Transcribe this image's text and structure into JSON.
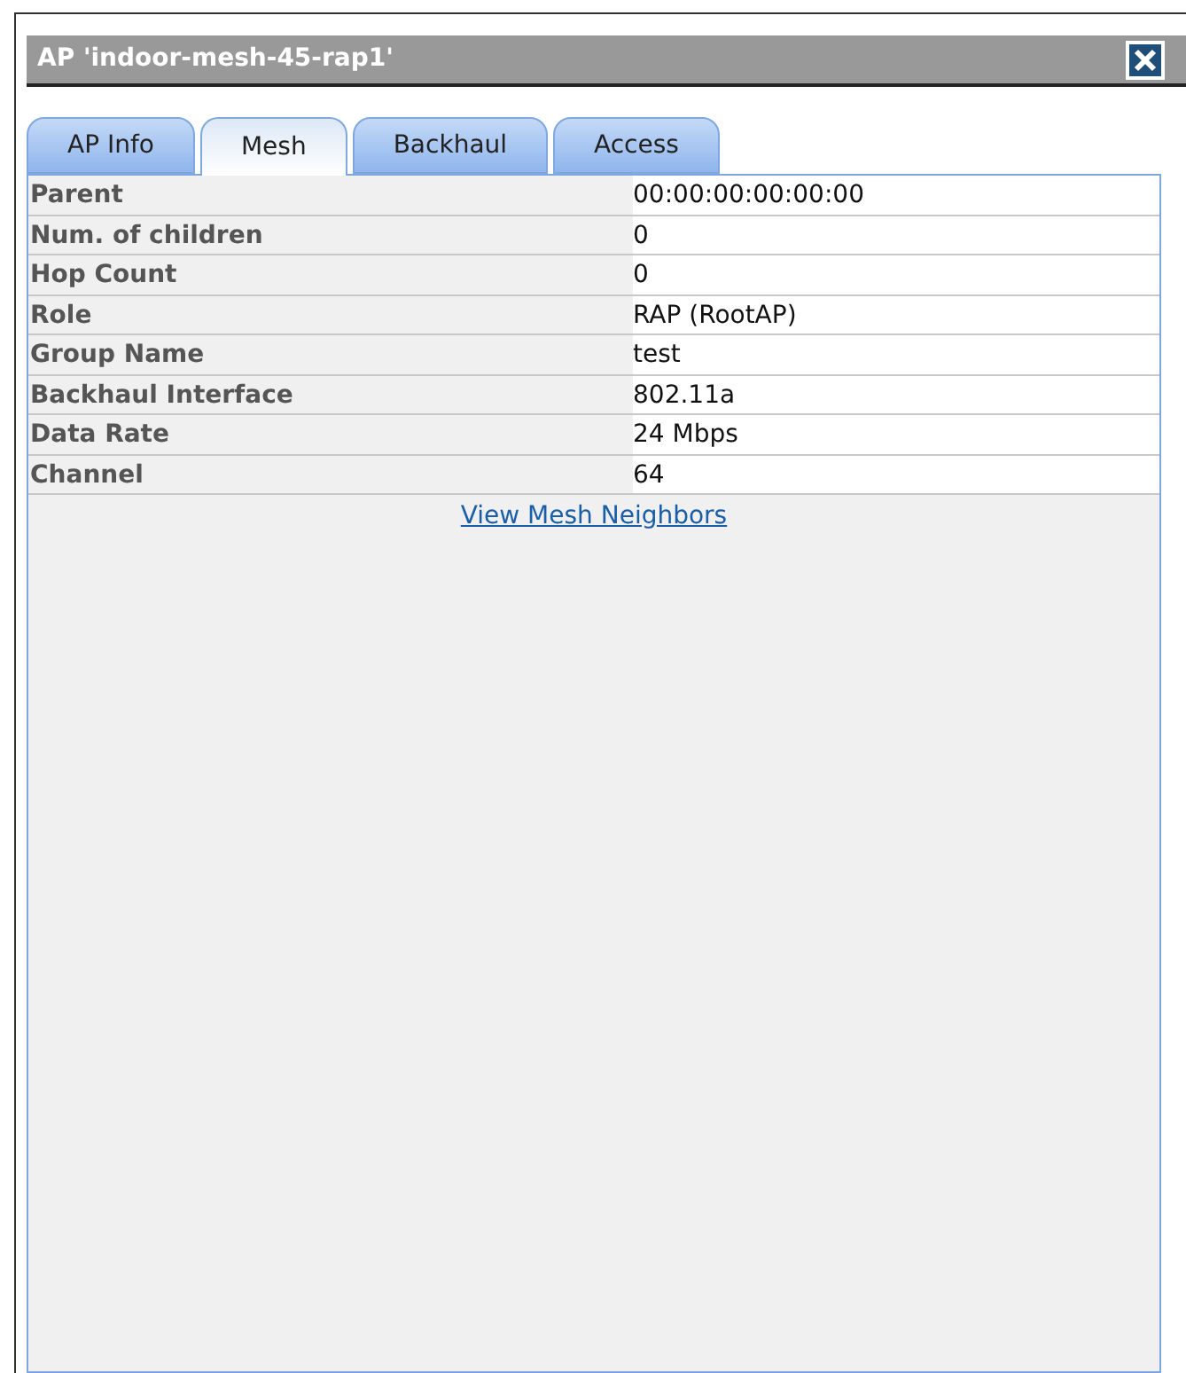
{
  "window": {
    "title": "AP 'indoor-mesh-45-rap1'"
  },
  "tabs": [
    {
      "label": "AP Info",
      "selected": false
    },
    {
      "label": "Mesh",
      "selected": true
    },
    {
      "label": "Backhaul",
      "selected": false
    },
    {
      "label": "Access",
      "selected": false
    }
  ],
  "table": {
    "rows": [
      {
        "label": "Parent",
        "value": "00:00:00:00:00:00"
      },
      {
        "label": "Num. of children",
        "value": "0"
      },
      {
        "label": "Hop Count",
        "value": "0"
      },
      {
        "label": "Role",
        "value": "RAP (RootAP)"
      },
      {
        "label": "Group Name",
        "value": "test"
      },
      {
        "label": "Backhaul Interface",
        "value": "802.11a"
      },
      {
        "label": "Data Rate",
        "value": "24 Mbps"
      },
      {
        "label": "Channel",
        "value": "64"
      }
    ]
  },
  "link": "View Mesh Neighbors"
}
